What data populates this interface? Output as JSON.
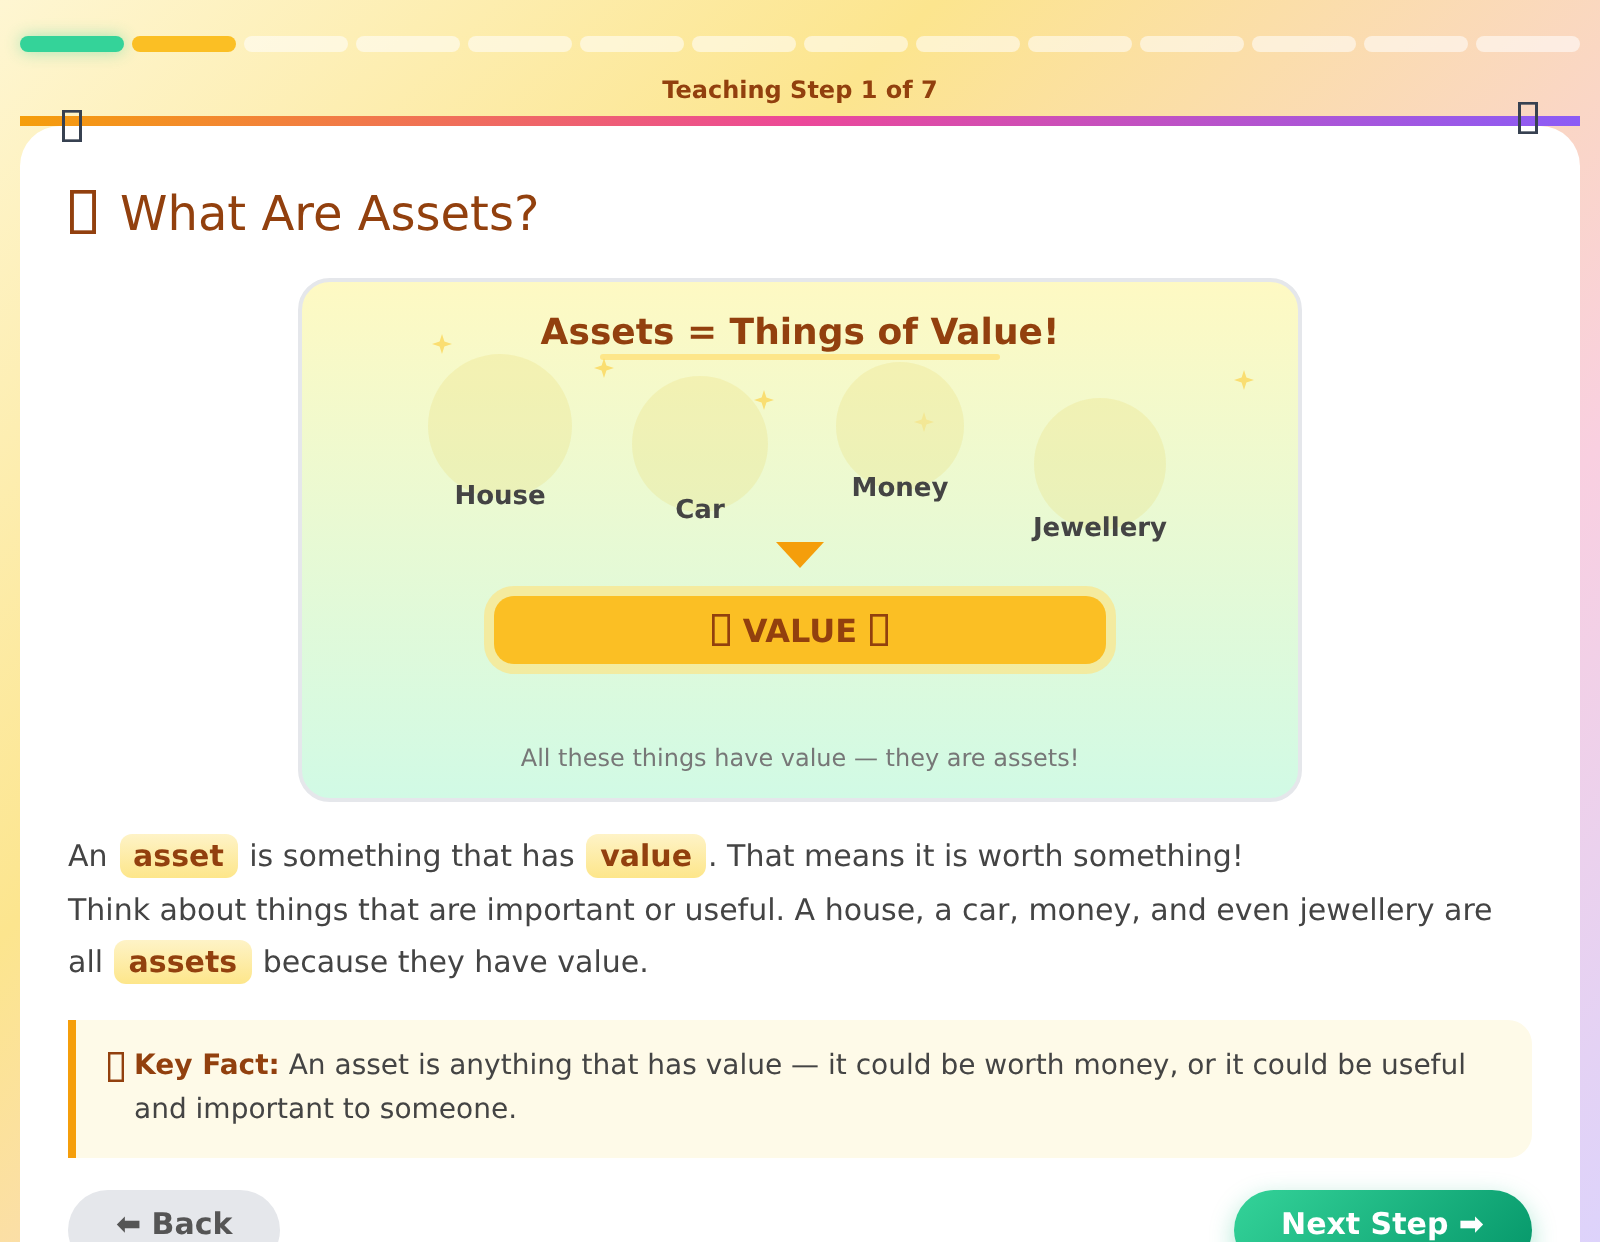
{
  "progress": {
    "segments": [
      {
        "done": true,
        "selected": false
      },
      {
        "done": false,
        "selected": true
      },
      {
        "done": false,
        "selected": false
      },
      {
        "done": false,
        "selected": false
      },
      {
        "done": false,
        "selected": false
      },
      {
        "done": false,
        "selected": false
      },
      {
        "done": false,
        "selected": false
      },
      {
        "done": false,
        "selected": false
      },
      {
        "done": false,
        "selected": false
      },
      {
        "done": false,
        "selected": false
      },
      {
        "done": false,
        "selected": false
      },
      {
        "done": false,
        "selected": false
      },
      {
        "done": false,
        "selected": false
      },
      {
        "done": false,
        "selected": false
      }
    ],
    "label": "Teaching Step 1 of 7"
  },
  "lesson": {
    "title": "What Are Assets?",
    "illustration": {
      "title": "Assets = Things of Value!",
      "items": [
        {
          "label": "House"
        },
        {
          "label": "Car"
        },
        {
          "label": "Money"
        },
        {
          "label": "Jewellery"
        }
      ],
      "result": "VALUE",
      "caption": "All these things have value — they are assets!"
    },
    "paragraphs": [
      "An **asset** is something that has **value**. That means it is worth something!",
      "Think about things that are important or useful. A house, a car, money, and even jewellery are all **assets** because they have value."
    ],
    "key_fact": "**Key Fact:** An asset is anything that has value — it could be worth money, or it could be useful and important to someone."
  },
  "buttons": [
    {
      "label": "⬅ Back",
      "kind": "back"
    },
    {
      "label": "Next Step ➡",
      "kind": "next"
    }
  ]
}
